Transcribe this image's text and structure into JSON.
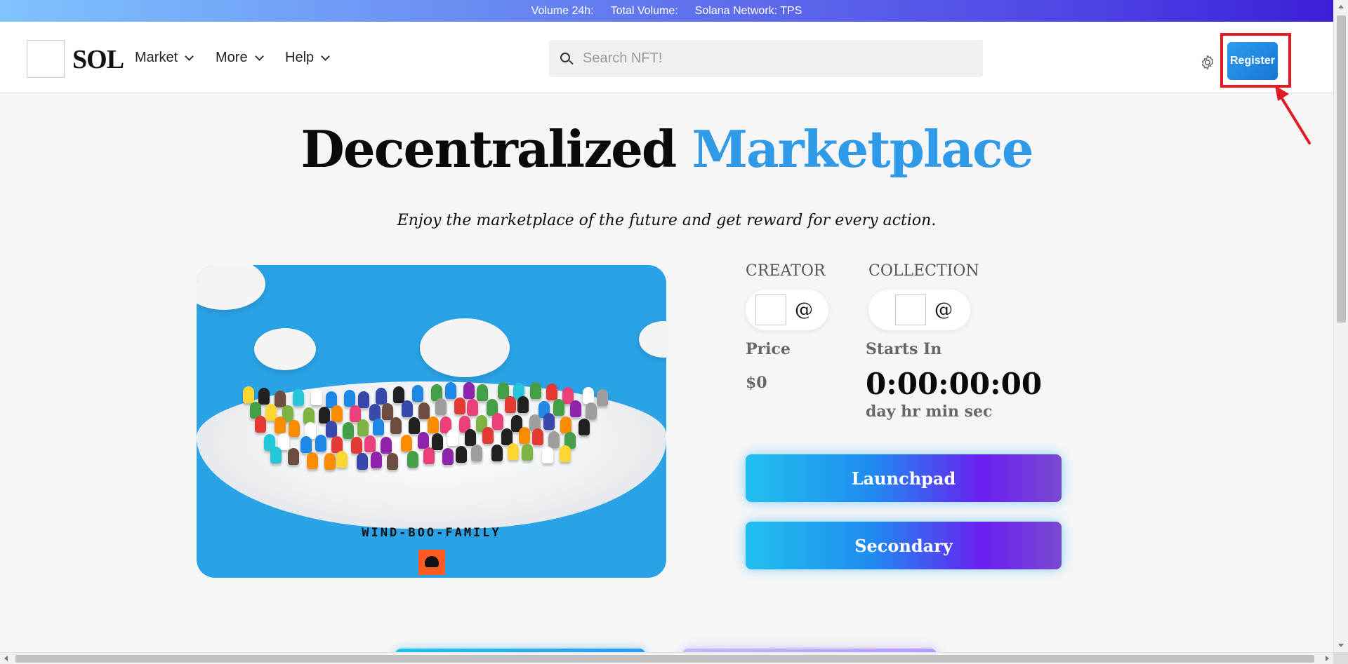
{
  "ticker": {
    "volume_24h": "Volume 24h:",
    "total_volume": "Total Volume:",
    "network": "Solana Network: TPS"
  },
  "header": {
    "logo_text": "SOL",
    "nav": [
      {
        "label": "Market"
      },
      {
        "label": "More"
      },
      {
        "label": "Help"
      }
    ],
    "search_placeholder": "Search NFT!",
    "register_label": "Register"
  },
  "hero": {
    "title_part1": "Decentralized",
    "title_part2": "Marketplace",
    "tagline": "Enjoy the marketplace of the future and get reward for every action."
  },
  "nft": {
    "name": "WIND-BOO-FAMILY"
  },
  "info": {
    "creator_label": "CREATOR",
    "collection_label": "COLLECTION",
    "creator_handle": "@",
    "collection_handle": "@",
    "price_label": "Price",
    "price_value": "$0",
    "starts_in_label": "Starts In",
    "countdown": "0:00:00:00",
    "countdown_units": "day hr min sec"
  },
  "actions": {
    "launchpad_label": "Launchpad",
    "secondary_label": "Secondary"
  },
  "colors": {
    "accent": "#2f9be8",
    "register_bg": "#1976d2",
    "highlight": "#e01b24"
  }
}
